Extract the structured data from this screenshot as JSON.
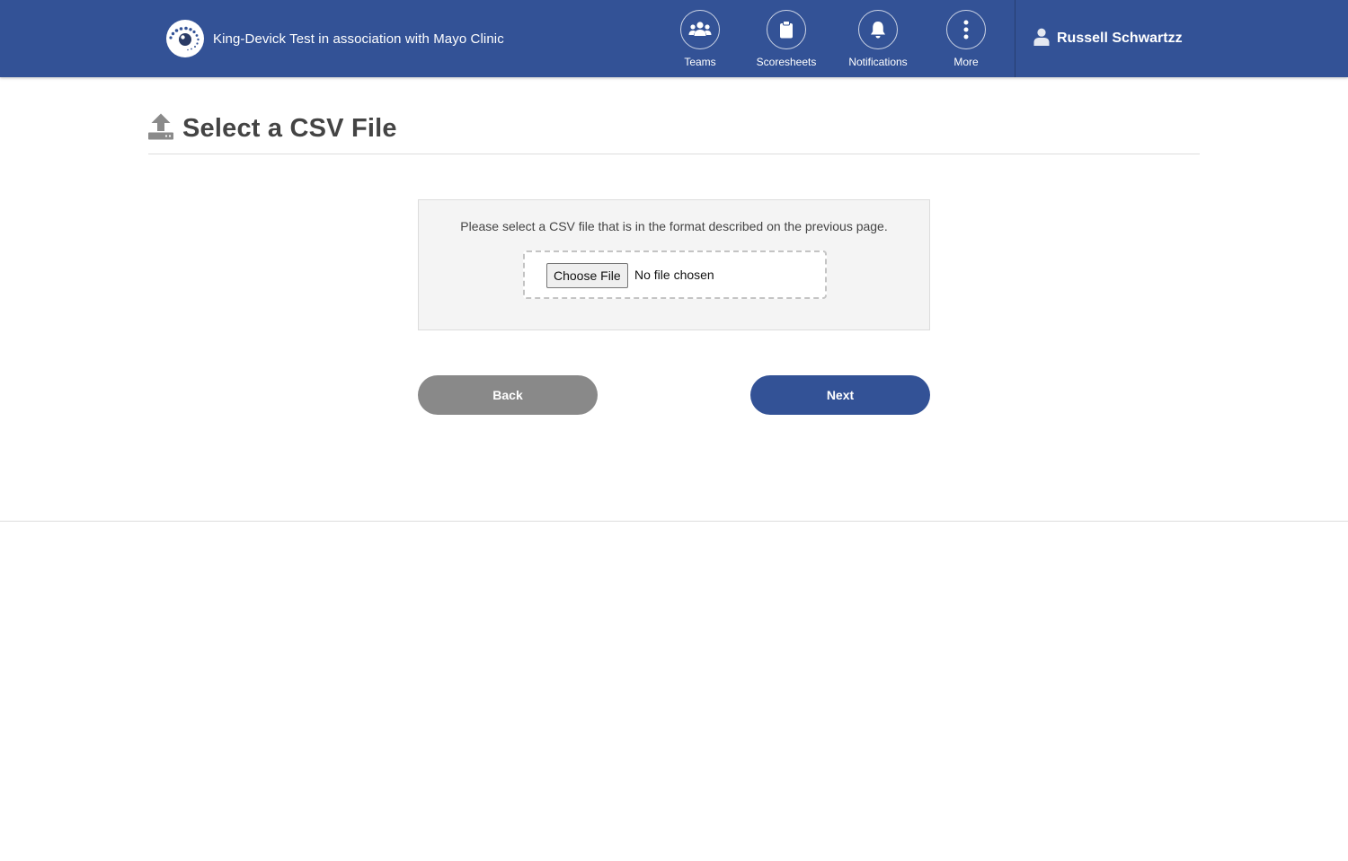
{
  "header": {
    "brand_name": "King-Devick Test in association with Mayo Clinic",
    "nav": [
      {
        "label": "Teams",
        "icon": "users-icon"
      },
      {
        "label": "Scoresheets",
        "icon": "clipboard-icon"
      },
      {
        "label": "Notifications",
        "icon": "bell-icon"
      },
      {
        "label": "More",
        "icon": "more-vertical-icon"
      }
    ],
    "user_name": "Russell Schwartzz"
  },
  "page": {
    "title": "Select a CSV File",
    "title_icon": "upload-icon"
  },
  "upload": {
    "instructions": "Please select a CSV file that is in the format described on the previous page.",
    "choose_label": "Choose File",
    "status": "No file chosen"
  },
  "actions": {
    "back_label": "Back",
    "next_label": "Next"
  },
  "colors": {
    "header_bg": "#335296",
    "primary_button": "#335296",
    "secondary_button": "#898989",
    "panel_bg": "#f4f4f4"
  }
}
